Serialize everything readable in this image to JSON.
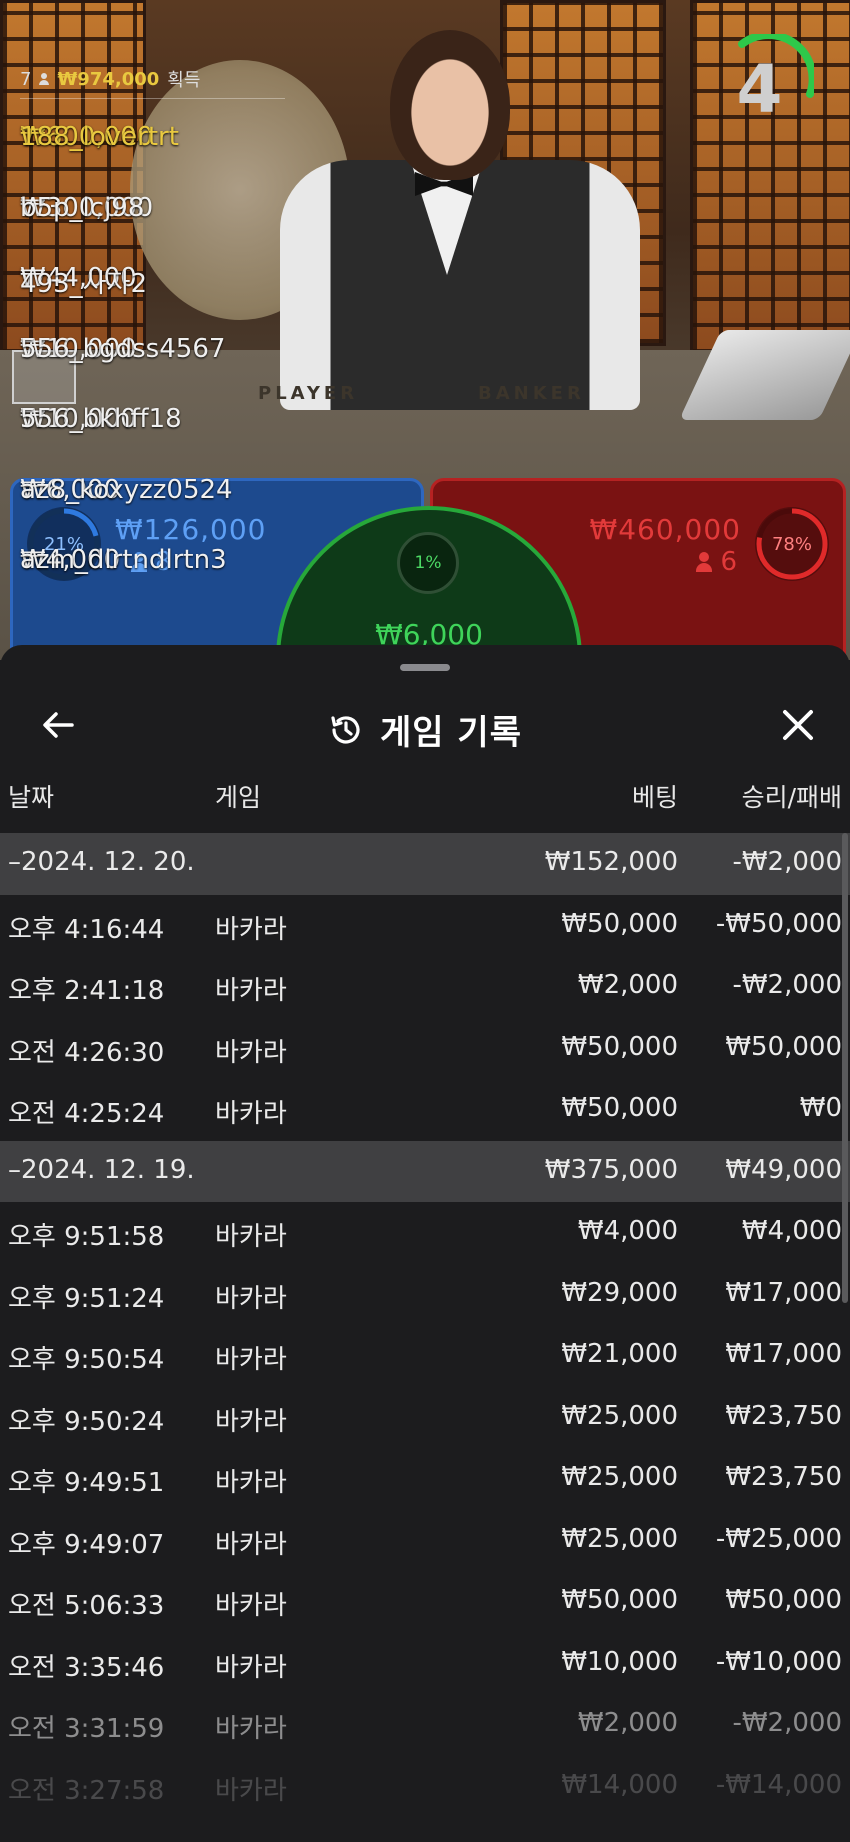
{
  "video": {
    "felt_player": "PLAYER",
    "felt_banker": "BANKER",
    "timer": "4",
    "winners": {
      "count": "7",
      "total": "₩974,000",
      "suffix": "획득",
      "rows": [
        {
          "amount": "₩600,000",
          "user": "188_lovertrt"
        },
        {
          "amount": "₩300,000",
          "user": "b5p_lcj98"
        },
        {
          "amount": "₩44,000",
          "user": "493_사자2"
        },
        {
          "amount": "₩10,000",
          "user": "556_bgdss4567"
        },
        {
          "amount": "₩10,000",
          "user": "556_bkhff18"
        },
        {
          "amount": "₩6,000",
          "user": "az8_koxyzz0524"
        },
        {
          "amount": "₩4,000",
          "user": "azm_dlrtndlrtn3"
        }
      ]
    },
    "player": {
      "pct": "21%",
      "pct_value": 21,
      "amount": "₩126,000",
      "count": "8",
      "color": "#2e67bf"
    },
    "banker": {
      "pct": "78%",
      "pct_value": 78,
      "amount": "₩460,000",
      "count": "6",
      "color": "#b52222"
    },
    "tie": {
      "pct": "1%",
      "pct_value": 1,
      "amount": "₩6,000",
      "color": "#27a83a"
    }
  },
  "sheet": {
    "title": "게임 기록",
    "icons": {
      "back": "arrow-left-icon",
      "history": "history-clock-icon",
      "close": "close-icon"
    },
    "columns": {
      "date": "날짜",
      "game": "게임",
      "bet": "베팅",
      "result": "승리/패배"
    },
    "rows": [
      {
        "type": "date",
        "c1": "–2024. 12. 20.",
        "c2": "",
        "c3": "₩152,000",
        "c4": "-₩2,000"
      },
      {
        "type": "item",
        "c1": "오후 4:16:44",
        "c2": "바카라",
        "c3": "₩50,000",
        "c4": "-₩50,000"
      },
      {
        "type": "item",
        "c1": "오후 2:41:18",
        "c2": "바카라",
        "c3": "₩2,000",
        "c4": "-₩2,000"
      },
      {
        "type": "item",
        "c1": "오전 4:26:30",
        "c2": "바카라",
        "c3": "₩50,000",
        "c4": "₩50,000"
      },
      {
        "type": "item",
        "c1": "오전 4:25:24",
        "c2": "바카라",
        "c3": "₩50,000",
        "c4": "₩0"
      },
      {
        "type": "date",
        "c1": "–2024. 12. 19.",
        "c2": "",
        "c3": "₩375,000",
        "c4": "₩49,000"
      },
      {
        "type": "item",
        "c1": "오후 9:51:58",
        "c2": "바카라",
        "c3": "₩4,000",
        "c4": "₩4,000"
      },
      {
        "type": "item",
        "c1": "오후 9:51:24",
        "c2": "바카라",
        "c3": "₩29,000",
        "c4": "₩17,000"
      },
      {
        "type": "item",
        "c1": "오후 9:50:54",
        "c2": "바카라",
        "c3": "₩21,000",
        "c4": "₩17,000"
      },
      {
        "type": "item",
        "c1": "오후 9:50:24",
        "c2": "바카라",
        "c3": "₩25,000",
        "c4": "₩23,750"
      },
      {
        "type": "item",
        "c1": "오후 9:49:51",
        "c2": "바카라",
        "c3": "₩25,000",
        "c4": "₩23,750"
      },
      {
        "type": "item",
        "c1": "오후 9:49:07",
        "c2": "바카라",
        "c3": "₩25,000",
        "c4": "-₩25,000"
      },
      {
        "type": "item",
        "c1": "오전 5:06:33",
        "c2": "바카라",
        "c3": "₩50,000",
        "c4": "₩50,000"
      },
      {
        "type": "item",
        "c1": "오전 3:35:46",
        "c2": "바카라",
        "c3": "₩10,000",
        "c4": "-₩10,000"
      },
      {
        "type": "item",
        "c1": "오전 3:31:59",
        "c2": "바카라",
        "c3": "₩2,000",
        "c4": "-₩2,000"
      },
      {
        "type": "item",
        "c1": "오전 3:27:58",
        "c2": "바카라",
        "c3": "₩14,000",
        "c4": "-₩14,000"
      }
    ]
  }
}
